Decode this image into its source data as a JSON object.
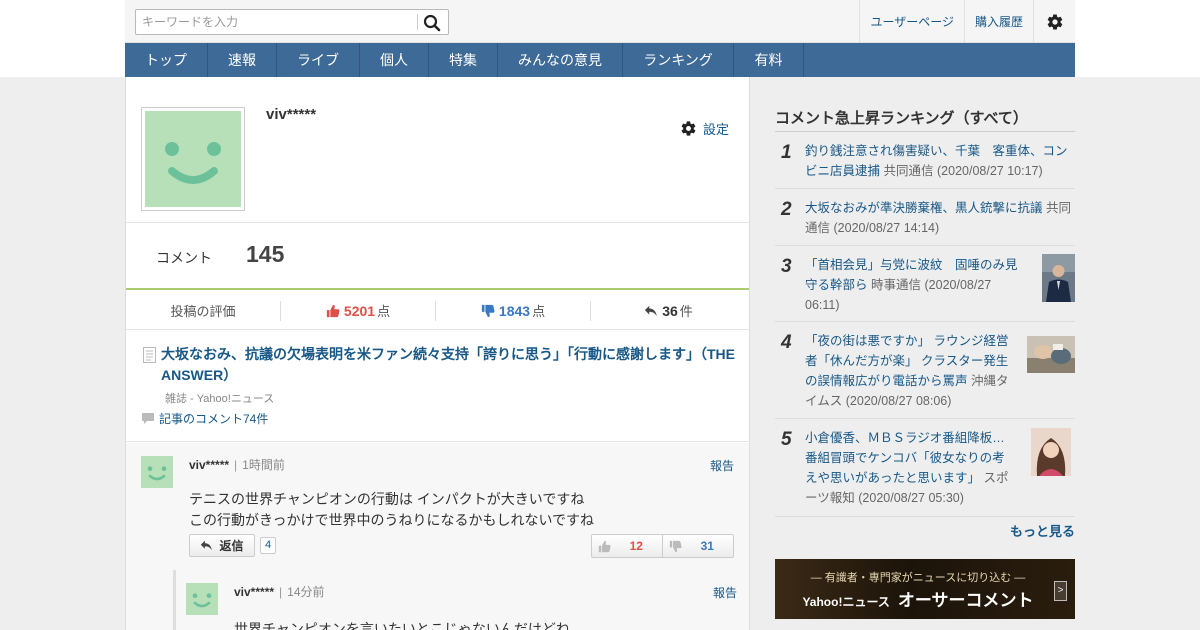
{
  "search": {
    "placeholder": "キーワードを入力"
  },
  "header_links": {
    "user_page": "ユーザーページ",
    "purchase_history": "購入履歴"
  },
  "nav": [
    "トップ",
    "速報",
    "ライブ",
    "個人",
    "特集",
    "みんなの意見",
    "ランキング",
    "有料"
  ],
  "profile": {
    "username": "viv*****",
    "settings_label": "設定",
    "comment_label": "コメント",
    "comment_count": "145"
  },
  "evaluation": {
    "label": "投稿の評価",
    "good": "5201",
    "good_unit": "点",
    "bad": "1843",
    "bad_unit": "点",
    "replies": "36",
    "replies_unit": "件"
  },
  "article": {
    "title": "大坂なおみ、抗議の欠場表明を米ファン続々支持「誇りに思う」「行動に感謝します」（THE ANSWER）",
    "source": "雑誌 - Yahoo!ニュース",
    "comments_link": "記事のコメント74件"
  },
  "comment": {
    "user": "viv*****",
    "time": "1時間前",
    "report": "報告",
    "line1": "テニスの世界チャンピオンの行動は インパクトが大きいですね",
    "line2": "この行動がきっかけで世界中のうねりになるかもしれないですね",
    "reply_label": "返信",
    "reply_count": "4",
    "good": "12",
    "bad": "31"
  },
  "reply": {
    "user": "viv*****",
    "time": "14分前",
    "report": "報告",
    "text": "世界チャンピオンを言いたいとこじゃないんだけどね"
  },
  "sidebar": {
    "title": "コメント急上昇ランキング（すべて）",
    "items": [
      {
        "rank": "1",
        "title": "釣り銭注意され傷害疑い、千葉　客重体、コンビニ店員逮捕",
        "source": "共同通信",
        "date": "(2020/08/27 10:17)"
      },
      {
        "rank": "2",
        "title": "大坂なおみが準決勝棄権、黒人銃撃に抗議",
        "source": "共同通信",
        "date": "(2020/08/27 14:14)"
      },
      {
        "rank": "3",
        "title": "「首相会見」与党に波紋　固唾のみ見守る幹部ら",
        "source": "時事通信",
        "date": "(2020/08/27 06:11)"
      },
      {
        "rank": "4",
        "title": "「夜の街は悪ですか」 ラウンジ経営者「休んだ方が楽」 クラスター発生の誤情報広がり電話から罵声",
        "source": "沖縄タイムス",
        "date": "(2020/08/27 08:06)"
      },
      {
        "rank": "5",
        "title": "小倉優香、ＭＢＳラジオ番組降板… 番組冒頭でケンコバ「彼女なりの考えや思いがあったと思います」",
        "source": "スポーツ報知",
        "date": "(2020/08/27 05:30)"
      }
    ],
    "more": "もっと見る",
    "banner_sub": "― 有識者・専門家がニュースに切り込む ―",
    "banner_brand": "Yahoo!ニュース",
    "banner_main": "オーサーコメント"
  },
  "colors": {
    "nav_bg": "#3d6a96",
    "link": "#185887",
    "good": "#e0504a",
    "bad": "#3b78c2",
    "accent_line": "#a8cc6e"
  }
}
